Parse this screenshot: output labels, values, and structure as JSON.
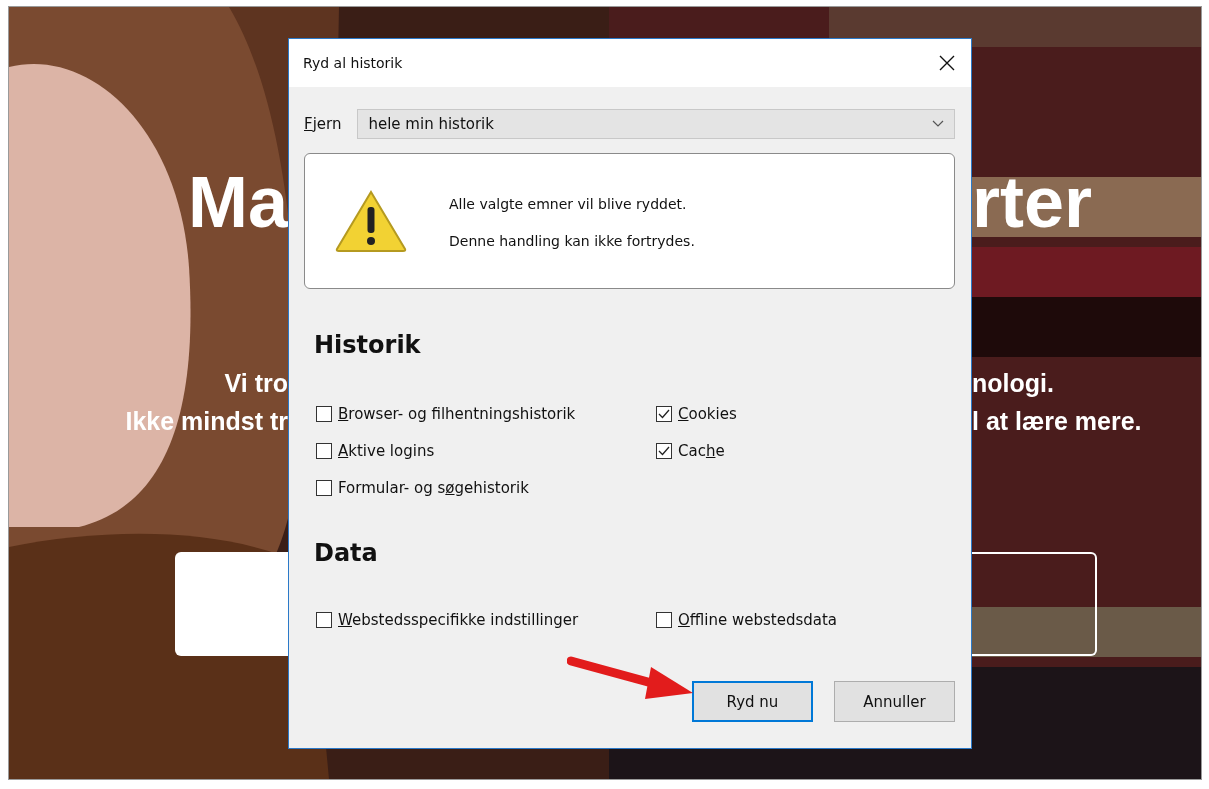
{
  "page": {
    "headline": [
      "Ma",
      "rter"
    ],
    "intro_lines": [
      [
        "Vi tro",
        "nologi."
      ],
      [
        "Ikke mindst tr",
        "l at lære mere."
      ]
    ],
    "buttons": [
      {
        "kind": "filled"
      },
      {
        "kind": "outline"
      }
    ]
  },
  "dialog": {
    "title": "Ryd al historik",
    "remove_label": {
      "key": "F",
      "post": "jern"
    },
    "remove_value": "hele min historik",
    "warning": [
      "Alle valgte emner vil blive ryddet.",
      "Denne handling kan ikke fortrydes."
    ],
    "sections": [
      {
        "title": "Historik",
        "options": [
          {
            "label": {
              "key": "B",
              "post": "rowser- og filhentningshistorik"
            },
            "checked": false
          },
          {
            "label": {
              "key": "C",
              "post": "ookies"
            },
            "checked": true
          },
          {
            "label": {
              "key": "A",
              "post": "ktive logins"
            },
            "checked": false
          },
          {
            "label": {
              "pre": "Cac",
              "key": "h",
              "post": "e"
            },
            "checked": true
          },
          {
            "label": {
              "pre": "Formular- og s",
              "key": "ø",
              "post": "gehistorik"
            },
            "checked": false
          }
        ]
      },
      {
        "title": "Data",
        "options": [
          {
            "label": {
              "key": "W",
              "post": "ebstedsspecifikke indstillinger"
            },
            "checked": false
          },
          {
            "label": {
              "key": "O",
              "post": "ffline webstedsdata"
            },
            "checked": false
          }
        ]
      }
    ],
    "buttons": [
      {
        "label": "Ryd nu",
        "default": true
      },
      {
        "label": "Annuller",
        "default": false
      }
    ]
  },
  "annotations": [
    {
      "kind": "arrow"
    }
  ]
}
